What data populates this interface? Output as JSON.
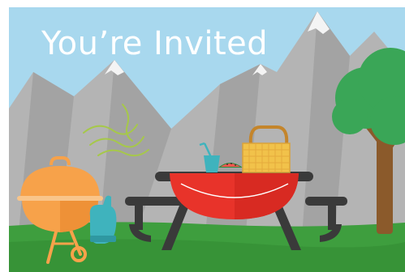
{
  "card": {
    "headline": "You’re Invited"
  },
  "colors": {
    "sky": "#a8d8ee",
    "mountain": "#b4b4b4",
    "mountain_shadow": "#9a9a9a",
    "snow": "#f4f4f4",
    "grass": "#3e9e3e",
    "table_top": "#e8332a",
    "table_frame": "#3a3a3a",
    "grill": "#f7a24a",
    "mitt": "#3fb3bd",
    "basket": "#f1c24a",
    "tree_foliage": "#3aa657",
    "tree_trunk": "#8b5a2b",
    "smoke": "#a6c84a"
  },
  "icons": [
    "mountain-range",
    "bbq-grill-icon",
    "oven-mitt-icon",
    "picnic-table-icon",
    "cup-with-straw-icon",
    "watermelon-slice-icon",
    "picnic-basket-icon",
    "tree-icon",
    "smoke-icon"
  ]
}
